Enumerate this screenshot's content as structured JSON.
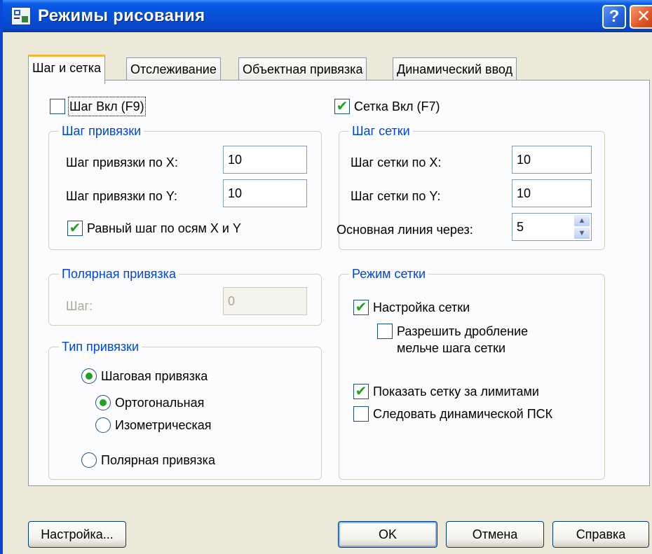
{
  "window": {
    "title": "Режимы рисования",
    "help_button": "?",
    "close_button": "✕"
  },
  "tabs": [
    {
      "label": "Шаг и сетка",
      "active": true
    },
    {
      "label": "Отслеживание"
    },
    {
      "label": "Объектная привязка"
    },
    {
      "label": "Динамический ввод"
    }
  ],
  "snap_toggle": {
    "label": "Шаг Вкл (F9)",
    "checked": false
  },
  "grid_toggle": {
    "label": "Сетка Вкл (F7)",
    "checked": true
  },
  "snap_spacing": {
    "legend": "Шаг привязки",
    "x_label": "Шаг привязки по X:",
    "x_value": "10",
    "y_label": "Шаг привязки по Y:",
    "y_value": "10",
    "equal_label": "Равный шаг по осям X и Y",
    "equal_checked": true
  },
  "polar_spacing": {
    "legend": "Полярная привязка",
    "step_label": "Шаг:",
    "step_value": "0"
  },
  "snap_type": {
    "legend": "Тип привязки",
    "grid_snap": "Шаговая привязка",
    "rectangular": "Ортогональная",
    "isometric": "Изометрическая",
    "polar_snap": "Полярная привязка",
    "selected": "grid_snap",
    "sub_selected": "rectangular"
  },
  "grid_spacing": {
    "legend": "Шаг сетки",
    "x_label": "Шаг сетки по X:",
    "x_value": "10",
    "y_label": "Шаг сетки по Y:",
    "y_value": "10",
    "major_label": "Основная линия через:",
    "major_value": "5"
  },
  "grid_behavior": {
    "legend": "Режим сетки",
    "adaptive_label": "Настройка сетки",
    "adaptive_checked": true,
    "subdivision_label_1": "Разрешить дробление",
    "subdivision_label_2": "мельче шага сетки",
    "subdivision_checked": false,
    "beyond_limits_label": "Показать сетку за лимитами",
    "beyond_limits_checked": true,
    "follow_ucs_label": "Следовать динамической ПСК",
    "follow_ucs_checked": false
  },
  "buttons": {
    "options": "Настройка...",
    "ok": "OK",
    "cancel": "Отмена",
    "help": "Справка"
  },
  "check_glyph": "✔"
}
